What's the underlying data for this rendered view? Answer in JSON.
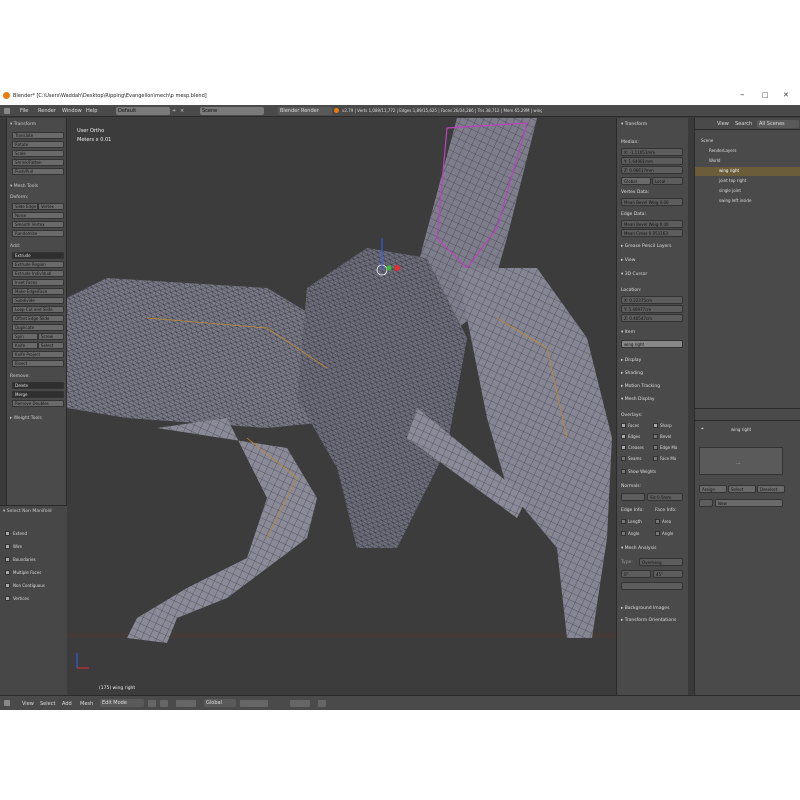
{
  "window": {
    "title": "Blender* [C:\\Users\\Waddah\\Desktop\\Ripping\\Evangelion\\mech\\p mesp.blend]",
    "minimize": "–",
    "maximize": "□",
    "close": "✕"
  },
  "menubar": {
    "menus": [
      "File",
      "Render",
      "Window",
      "Help"
    ],
    "layout": "Default",
    "scene": "Scene",
    "engine": "Blender Render",
    "stats": "v2.79 | Verts 1,089/11,772 | Edges 1,89/15,625 | Faces 26/24,286 | Tris 38,712 | Mem 65.29M | wing right"
  },
  "left_panel": {
    "transform_header": "Transform",
    "transform_buttons": [
      "Translate",
      "Rotate",
      "Scale",
      "Shrink/Fatten",
      "Push/Pull"
    ],
    "mesh_tools_header": "Mesh Tools",
    "deform_label": "Deform:",
    "deform_buttons": [
      "Slide Edge",
      "Vertex",
      "Noise",
      "Smooth Vertex",
      "Randomize"
    ],
    "add_label": "Add:",
    "add_buttons": [
      "Extrude",
      "Extrude Region",
      "Extrude Individual",
      "Inset Faces",
      "Make Edge/Face",
      "Subdivide",
      "Loop Cut and Slide",
      "Offset Edge Slide",
      "Duplicate",
      "Spin",
      "Screw",
      "Knife",
      "Select",
      "Knife Project",
      "Bisect"
    ],
    "remove_label": "Remove:",
    "remove_buttons": [
      "Delete",
      "Merge",
      "Remove Doubles"
    ],
    "weight_tools_header": "Weight Tools",
    "select_header": "Select Non Manifold",
    "select_options": [
      "Extend",
      "Wire",
      "Boundaries",
      "Multiple Faces",
      "Non Contiguous",
      "Vertices"
    ]
  },
  "viewport": {
    "view_name": "User Ortho",
    "unit": "Meters x 0.01",
    "object_label": "(175) wing right"
  },
  "properties_panel": {
    "transform_header": "Transform",
    "median_label": "Median:",
    "median_values": [
      {
        "axis": "X",
        "value": "-1.11051mm"
      },
      {
        "axis": "Y",
        "value": "1.64001mm"
      },
      {
        "axis": "Z",
        "value": "0.96617mm"
      }
    ],
    "global_label": "Global",
    "local_label": "Local",
    "vertex_data_label": "Vertex Data:",
    "mean_bevel_weight_v": "Mean Bevel Weig  0.00",
    "edge_data_label": "Edge Data:",
    "mean_bevel_weight_e": "Mean Bevel Weig  0.00",
    "mean_crease": "Mean Creas  0.051163",
    "grease_pencil_header": "Grease Pencil Layers",
    "view_header": "View",
    "cursor_header": "3D Cursor",
    "location_label": "Location:",
    "cursor_values": [
      {
        "axis": "X",
        "value": "0.22375cm"
      },
      {
        "axis": "Y",
        "value": "5.40977cm"
      },
      {
        "axis": "Z",
        "value": "0.40547cm"
      }
    ],
    "item_header": "Item",
    "item_name": "wing right",
    "display_header": "Display",
    "shading_header": "Shading",
    "motion_tracking_header": "Motion Tracking",
    "mesh_display_header": "Mesh Display",
    "overlays_label": "Overlays:",
    "overlays": [
      {
        "label": "Faces",
        "on": true
      },
      {
        "label": "Sharp",
        "on": true
      },
      {
        "label": "Edges",
        "on": true
      },
      {
        "label": "Bevel",
        "on": false
      },
      {
        "label": "Creases",
        "on": true
      },
      {
        "label": "Edge Ma",
        "on": false
      },
      {
        "label": "Seams",
        "on": false
      },
      {
        "label": "Face Ma",
        "on": false
      }
    ],
    "show_weights": "Show Weights",
    "normals_label": "Normals:",
    "normals_size": "Siz 0.5mm",
    "edge_info_label": "Edge Info:",
    "face_info_label": "Face Info:",
    "edge_info": [
      "Length",
      "Angle"
    ],
    "face_info": [
      "Area",
      "Angle"
    ],
    "mesh_analysis_header": "Mesh Analysis",
    "type_label": "Type:",
    "type_value": "Overhang",
    "range_min": "0°",
    "range_max": "45°",
    "background_images_header": "Background Images",
    "transform_orientations_header": "Transform Orientations"
  },
  "outliner": {
    "view": "View",
    "search": "Search",
    "filter": "All Scenes",
    "items": [
      "Scene",
      "RenderLayers",
      "World",
      "wing right",
      "joint top right",
      "single joint",
      "swing left inside"
    ]
  },
  "properties_right": {
    "object_name": "wing right",
    "placeholder": "...",
    "assign": "Assign",
    "select": "Select",
    "deselect": "Deselect",
    "new": "New"
  },
  "bottombar": {
    "menus": [
      "View",
      "Select",
      "Add",
      "Mesh"
    ],
    "mode": "Edit Mode",
    "orientation": "Global"
  }
}
